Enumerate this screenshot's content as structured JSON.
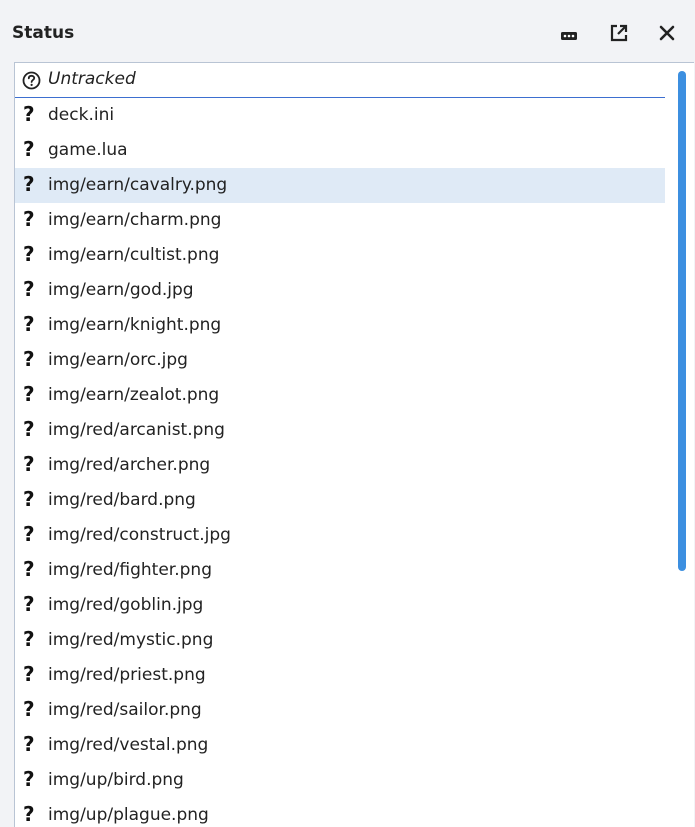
{
  "header": {
    "title": "Status"
  },
  "icons": {
    "more": "more-icon",
    "popout": "popout-icon",
    "close": "close-icon",
    "untracked": "question-circle-icon",
    "file": "question-icon"
  },
  "group": {
    "label": "Untracked"
  },
  "file_icon_glyph": "?",
  "files": [
    {
      "name": "deck.ini"
    },
    {
      "name": "game.lua"
    },
    {
      "name": "img/earn/cavalry.png",
      "selected": true
    },
    {
      "name": "img/earn/charm.png"
    },
    {
      "name": "img/earn/cultist.png"
    },
    {
      "name": "img/earn/god.jpg"
    },
    {
      "name": "img/earn/knight.png"
    },
    {
      "name": "img/earn/orc.jpg"
    },
    {
      "name": "img/earn/zealot.png"
    },
    {
      "name": "img/red/arcanist.png"
    },
    {
      "name": "img/red/archer.png"
    },
    {
      "name": "img/red/bard.png"
    },
    {
      "name": "img/red/construct.jpg"
    },
    {
      "name": "img/red/fighter.png"
    },
    {
      "name": "img/red/goblin.jpg"
    },
    {
      "name": "img/red/mystic.png"
    },
    {
      "name": "img/red/priest.png"
    },
    {
      "name": "img/red/sailor.png"
    },
    {
      "name": "img/red/vestal.png"
    },
    {
      "name": "img/up/bird.png"
    },
    {
      "name": "img/up/plague.png"
    }
  ],
  "colors": {
    "accent": "#3c8fe0",
    "selected_row": "#dfeaf6",
    "group_underline": "#3d6fd0"
  }
}
